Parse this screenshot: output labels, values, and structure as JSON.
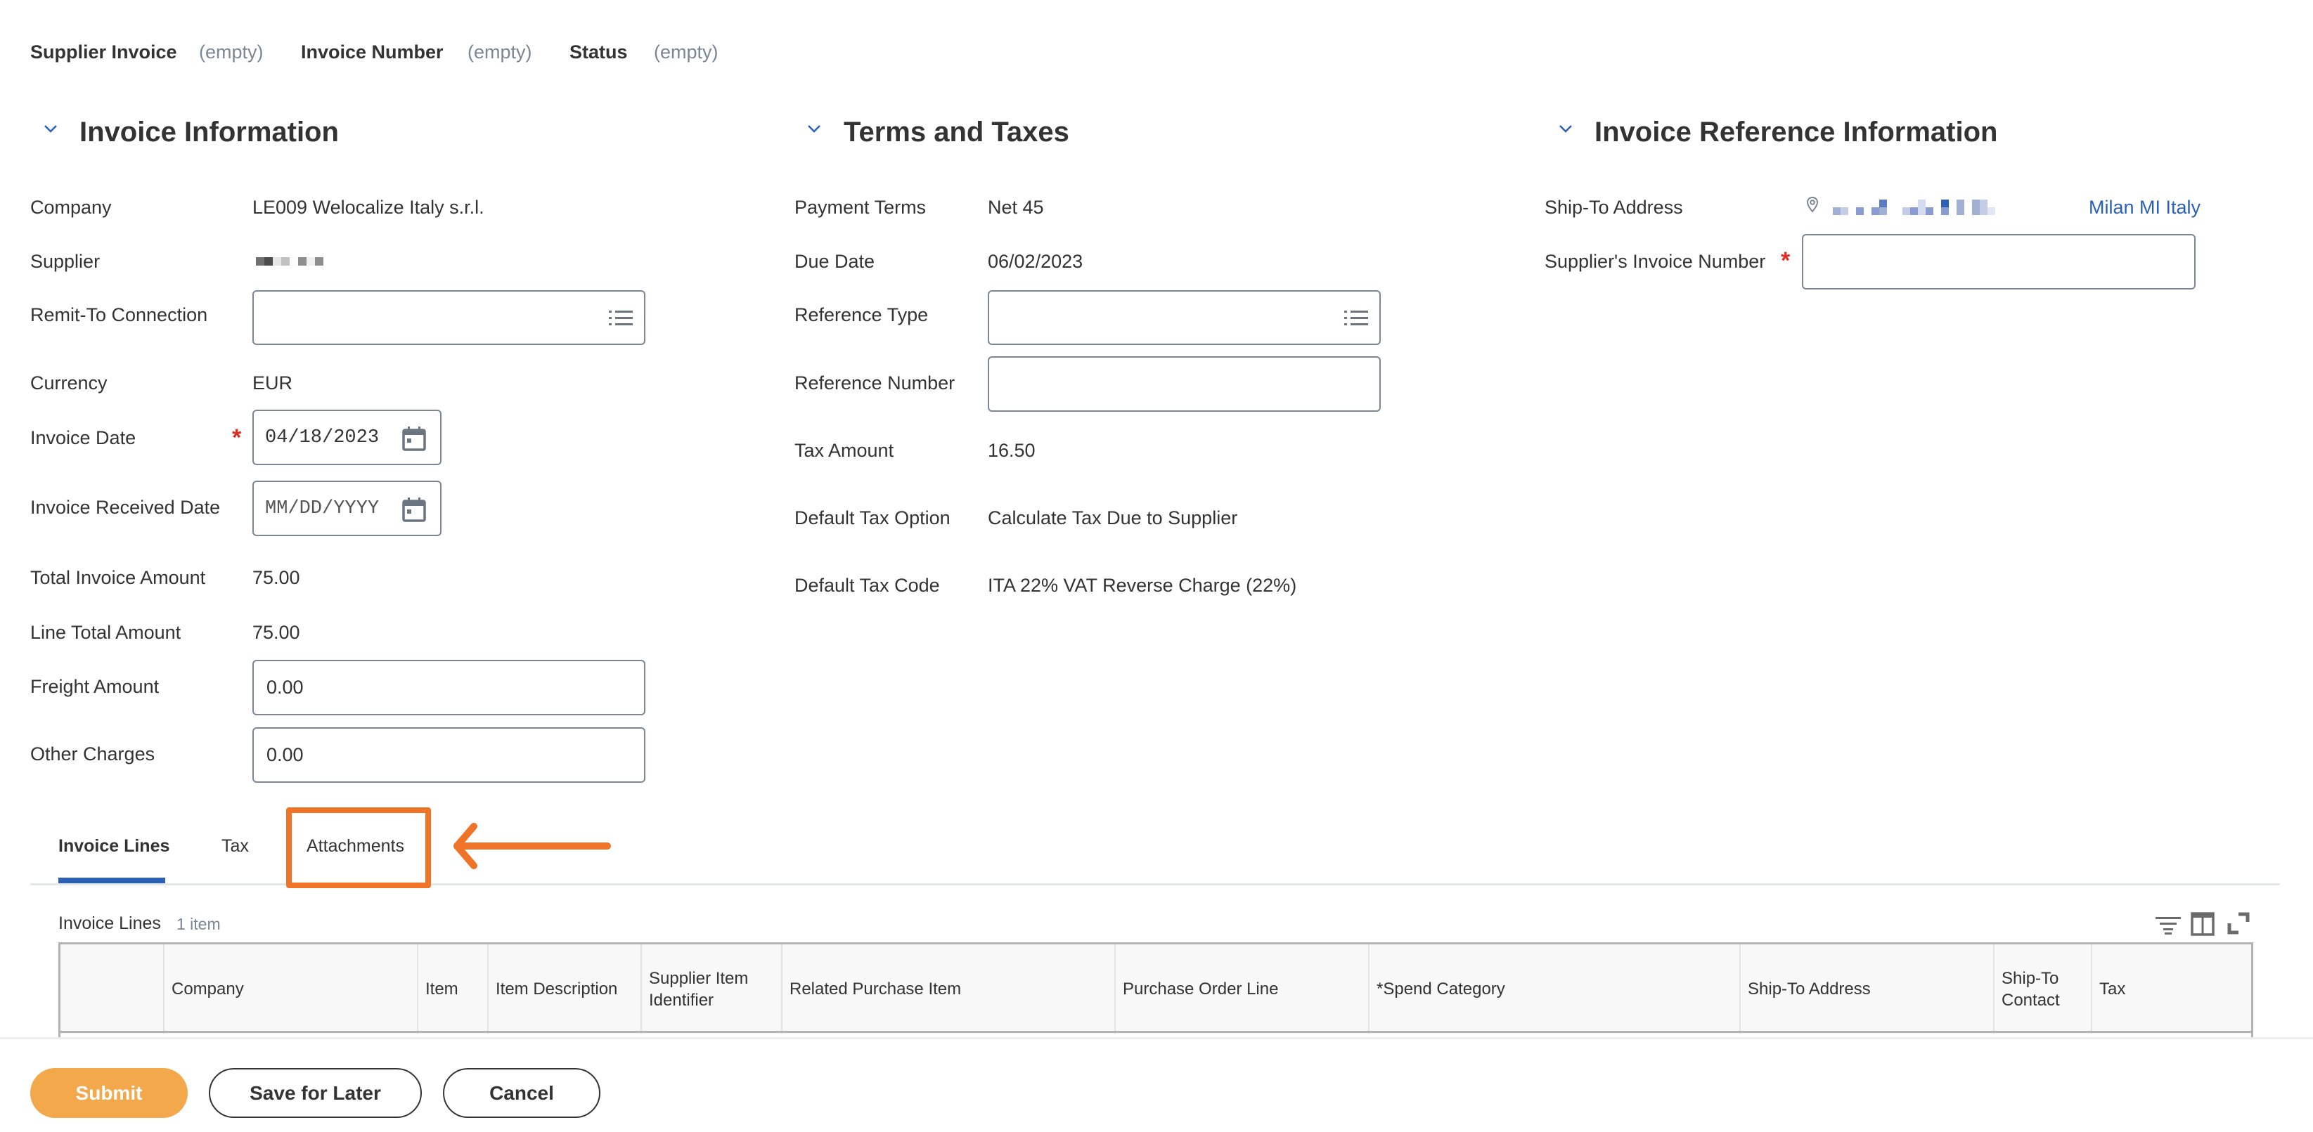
{
  "header": {
    "fields": [
      {
        "label": "Supplier Invoice",
        "value": "(empty)"
      },
      {
        "label": "Invoice Number",
        "value": "(empty)"
      },
      {
        "label": "Status",
        "value": "(empty)"
      }
    ]
  },
  "sections": {
    "invoice_info": {
      "title": "Invoice Information",
      "company_label": "Company",
      "company_value": "LE009 Welocalize Italy s.r.l.",
      "supplier_label": "Supplier",
      "supplier_value": "[redacted]",
      "remit_label": "Remit-To Connection",
      "remit_value": "",
      "currency_label": "Currency",
      "currency_value": "EUR",
      "invoice_date_label": "Invoice Date",
      "invoice_date_value": "04/18/2023",
      "received_date_label": "Invoice Received Date",
      "received_date_placeholder": "MM/DD/YYYY",
      "total_label": "Total Invoice Amount",
      "total_value": "75.00",
      "line_total_label": "Line Total Amount",
      "line_total_value": "75.00",
      "freight_label": "Freight Amount",
      "freight_value": "0.00",
      "other_label": "Other Charges",
      "other_value": "0.00"
    },
    "terms": {
      "title": "Terms and Taxes",
      "payment_terms_label": "Payment Terms",
      "payment_terms_value": "Net 45",
      "due_date_label": "Due Date",
      "due_date_value": "06/02/2023",
      "ref_type_label": "Reference Type",
      "ref_type_value": "",
      "ref_number_label": "Reference Number",
      "ref_number_value": "",
      "tax_amount_label": "Tax Amount",
      "tax_amount_value": "16.50",
      "tax_option_label": "Default Tax Option",
      "tax_option_value": "Calculate Tax Due to Supplier",
      "tax_code_label": "Default Tax Code",
      "tax_code_value": "ITA 22% VAT Reverse Charge (22%)"
    },
    "reference": {
      "title": "Invoice Reference Information",
      "ship_to_label": "Ship-To Address",
      "ship_to_value": "Milan MI Italy",
      "supplier_invoice_number_label": "Supplier's Invoice Number",
      "supplier_invoice_number_value": ""
    }
  },
  "tabs": [
    {
      "label": "Invoice Lines",
      "active": true
    },
    {
      "label": "Tax",
      "active": false
    },
    {
      "label": "Attachments",
      "active": false,
      "highlighted": true
    }
  ],
  "invoice_lines": {
    "title": "Invoice Lines",
    "count": "1 item",
    "columns": [
      "",
      "Company",
      "Item",
      "Item Description",
      "Supplier Item Identifier",
      "Related Purchase Item",
      "Purchase Order Line",
      "*Spend Category",
      "Ship-To Address",
      "Ship-To Contact",
      "Tax"
    ]
  },
  "footer": {
    "submit": "Submit",
    "save_for_later": "Save for Later",
    "cancel": "Cancel"
  },
  "colors": {
    "accent_blue": "#2a60b8",
    "submit_orange": "#f2a84b",
    "annotation_orange": "#f07427",
    "required_red": "#de2e21"
  }
}
